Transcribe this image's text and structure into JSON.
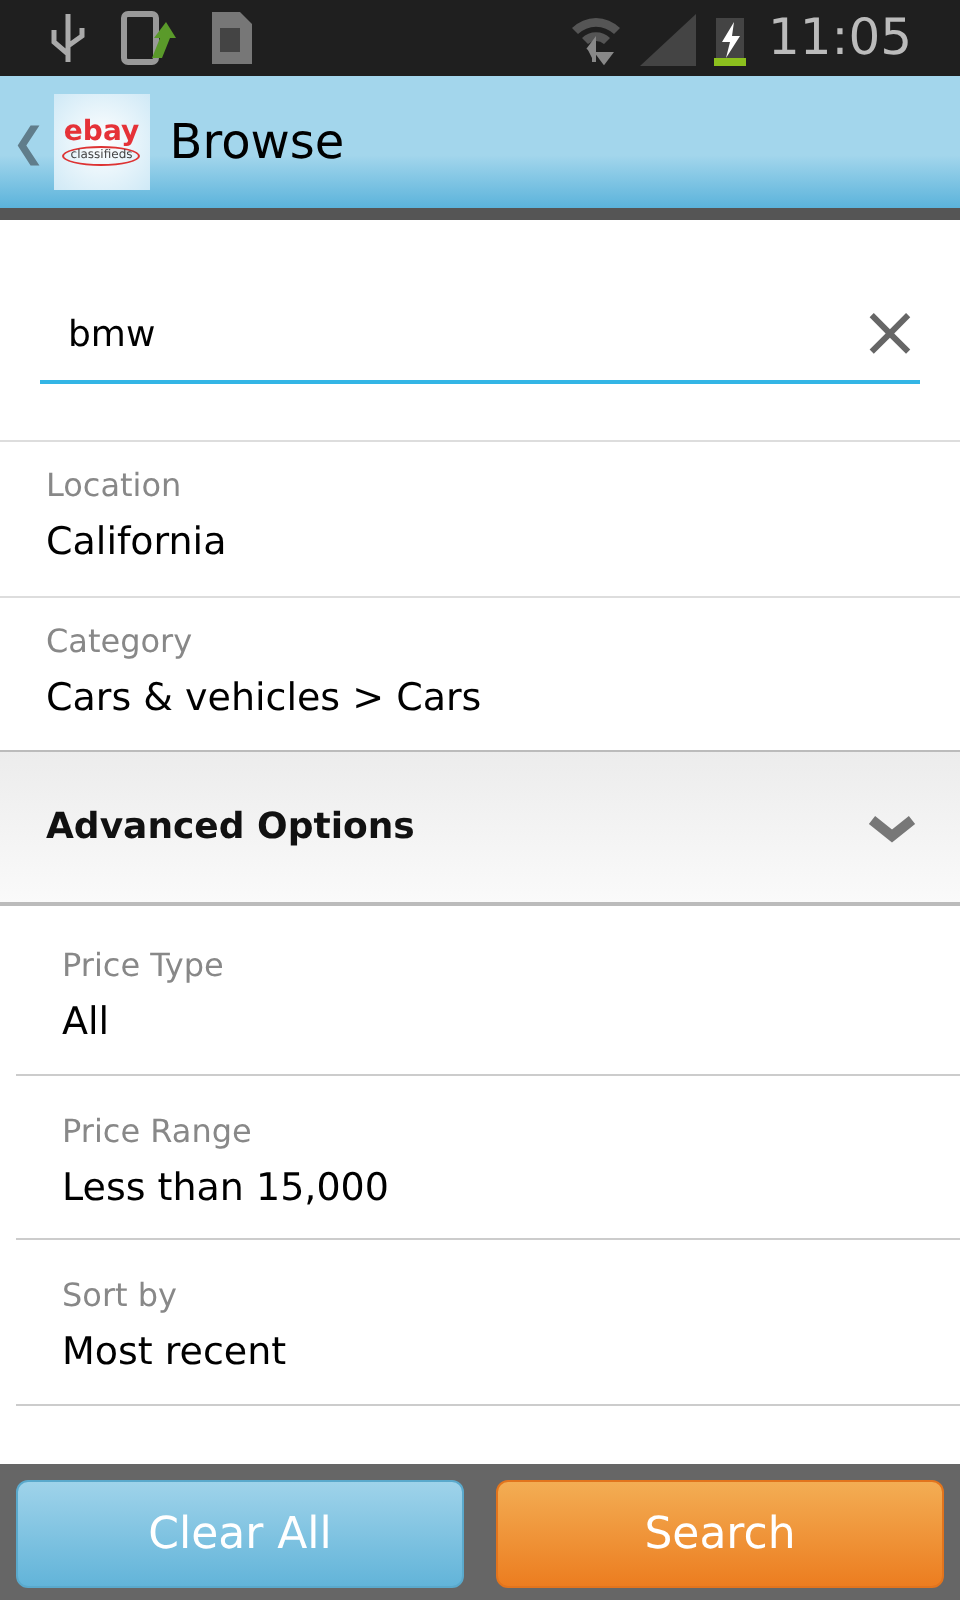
{
  "status_bar": {
    "time": "11:05",
    "battery_charging": true
  },
  "header": {
    "back": "❮",
    "logo": {
      "brand": "ebay",
      "sub": "classifieds"
    },
    "title": "Browse"
  },
  "search": {
    "value": "bmw",
    "clear": "×"
  },
  "fields": [
    {
      "label": "Location",
      "value": "California"
    },
    {
      "label": "Category",
      "value": "Cars & vehicles > Cars"
    }
  ],
  "advanced": {
    "title": "Advanced Options",
    "expanded": true,
    "fields": [
      {
        "label": "Price Type",
        "value": "All"
      },
      {
        "label": "Price Range",
        "value": "Less than 15,000"
      },
      {
        "label": "Sort by",
        "value": "Most recent"
      }
    ]
  },
  "buttons": [
    {
      "label": "Clear All",
      "kind": "secondary"
    },
    {
      "label": "Search",
      "kind": "primary"
    }
  ]
}
